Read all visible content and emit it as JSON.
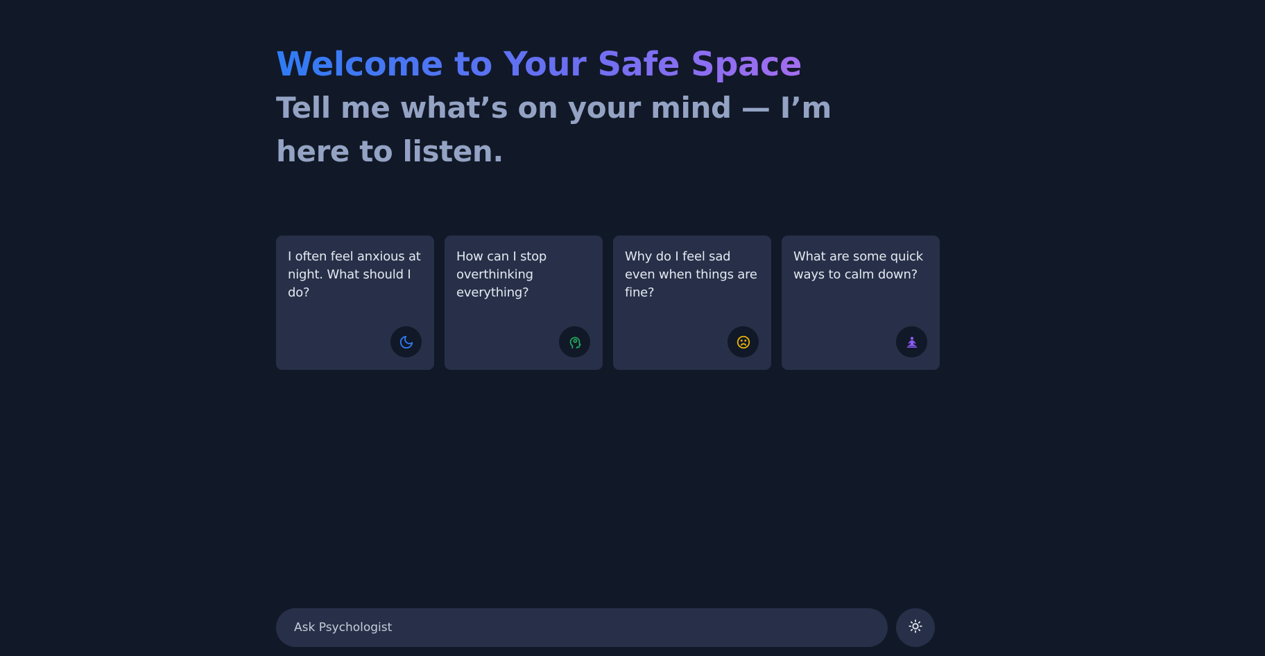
{
  "hero": {
    "title": "Welcome to Your Safe Space",
    "subtitle": "Tell me what’s on your mind — I’m here to listen."
  },
  "cards": [
    {
      "text": "I often feel anxious at night. What should I do?",
      "icon": "moon-icon",
      "icon_color": "#2f7cf4"
    },
    {
      "text": "How can I stop overthinking everything?",
      "icon": "brain-head-icon",
      "icon_color": "#22a35a"
    },
    {
      "text": "Why do I feel sad even when things are fine?",
      "icon": "sad-face-icon",
      "icon_color": "#eab308"
    },
    {
      "text": "What are some quick ways to calm down?",
      "icon": "meditation-icon",
      "icon_color": "#8b5cf6"
    }
  ],
  "chat_input": {
    "placeholder": "Ask Psychologist",
    "value": ""
  },
  "theme_toggle": {
    "icon": "sun-icon"
  },
  "colors": {
    "background": "#111827",
    "card": "#273048",
    "gradient_start": "#2f7cf4",
    "gradient_end": "#a36ef0",
    "subtitle": "#94a3c4"
  }
}
